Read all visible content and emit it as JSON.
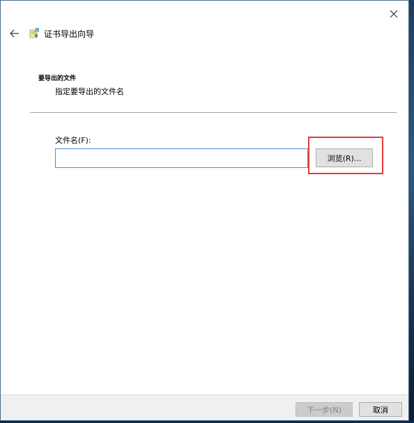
{
  "window": {
    "title": "证书导出向导"
  },
  "content": {
    "heading": "要导出的文件",
    "subheading": "指定要导出的文件名",
    "filename_label": "文件名(F):",
    "filename_value": "",
    "browse_label": "浏览(R)..."
  },
  "footer": {
    "next_label": "下一步(N)",
    "cancel_label": "取消"
  },
  "icons": {
    "close": "close-icon",
    "back": "back-arrow-icon",
    "wizard": "certificate-icon"
  },
  "colors": {
    "highlight": "#e53935",
    "input_border": "#4b8ed6"
  }
}
